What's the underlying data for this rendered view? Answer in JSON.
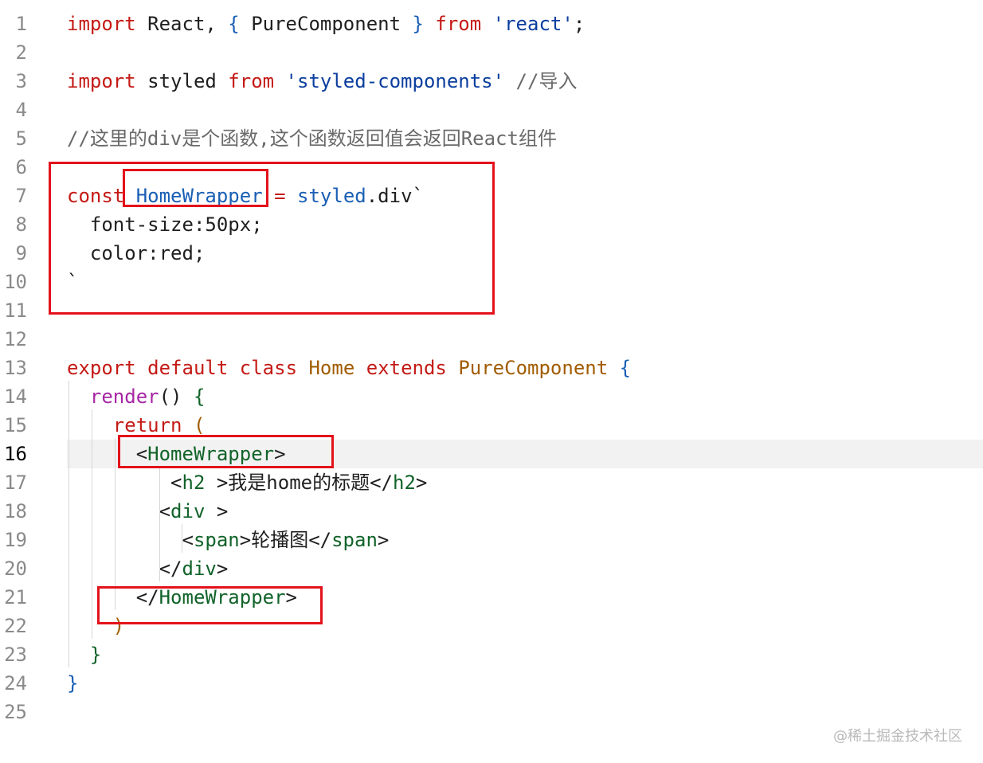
{
  "colors": {
    "keyword": "#c41a16",
    "method": "#a626a4",
    "string": "#0b3e9e",
    "comment": "#6a6a6a",
    "tag": "#116329",
    "class_name": "#a15c00",
    "annotation_box": "#e3121b",
    "current_line_bg": "#f2f2f2"
  },
  "lines": [
    {
      "n": "1",
      "tokens": [
        {
          "c": "kw",
          "t": "import"
        },
        {
          "c": "plain",
          "t": " React, "
        },
        {
          "c": "brace",
          "t": "{"
        },
        {
          "c": "plain",
          "t": " PureComponent "
        },
        {
          "c": "brace",
          "t": "}"
        },
        {
          "c": "plain",
          "t": " "
        },
        {
          "c": "kw",
          "t": "from"
        },
        {
          "c": "plain",
          "t": " "
        },
        {
          "c": "str",
          "t": "'react'"
        },
        {
          "c": "plain",
          "t": ";"
        }
      ]
    },
    {
      "n": "2",
      "tokens": []
    },
    {
      "n": "3",
      "tokens": [
        {
          "c": "kw",
          "t": "import"
        },
        {
          "c": "plain",
          "t": " styled "
        },
        {
          "c": "kw",
          "t": "from"
        },
        {
          "c": "plain",
          "t": " "
        },
        {
          "c": "str",
          "t": "'styled-components'"
        },
        {
          "c": "plain",
          "t": " "
        },
        {
          "c": "cm",
          "t": "//导入"
        }
      ]
    },
    {
      "n": "4",
      "tokens": []
    },
    {
      "n": "5",
      "tokens": [
        {
          "c": "cm",
          "t": "//这里的div是个函数,这个函数返回值会返回React组件"
        }
      ]
    },
    {
      "n": "6",
      "tokens": []
    },
    {
      "n": "7",
      "tokens": [
        {
          "c": "kw",
          "t": "const"
        },
        {
          "c": "plain",
          "t": " "
        },
        {
          "c": "fn",
          "t": "HomeWrapper"
        },
        {
          "c": "plain",
          "t": " "
        },
        {
          "c": "kw",
          "t": "="
        },
        {
          "c": "plain",
          "t": " "
        },
        {
          "c": "fn",
          "t": "styled"
        },
        {
          "c": "plain",
          "t": ".div`"
        }
      ]
    },
    {
      "n": "8",
      "tokens": [
        {
          "c": "plain",
          "t": "  font-size:50px;"
        }
      ]
    },
    {
      "n": "9",
      "tokens": [
        {
          "c": "plain",
          "t": "  color:red;"
        }
      ]
    },
    {
      "n": "10",
      "tokens": [
        {
          "c": "plain",
          "t": "`"
        }
      ]
    },
    {
      "n": "11",
      "tokens": []
    },
    {
      "n": "12",
      "tokens": []
    },
    {
      "n": "13",
      "tokens": [
        {
          "c": "kw",
          "t": "export"
        },
        {
          "c": "plain",
          "t": " "
        },
        {
          "c": "kw",
          "t": "default"
        },
        {
          "c": "plain",
          "t": " "
        },
        {
          "c": "kw",
          "t": "class"
        },
        {
          "c": "plain",
          "t": " "
        },
        {
          "c": "cls",
          "t": "Home"
        },
        {
          "c": "plain",
          "t": " "
        },
        {
          "c": "kw",
          "t": "extends"
        },
        {
          "c": "plain",
          "t": " "
        },
        {
          "c": "cls",
          "t": "PureComponent"
        },
        {
          "c": "plain",
          "t": " "
        },
        {
          "c": "brace",
          "t": "{"
        }
      ]
    },
    {
      "n": "14",
      "tokens": [
        {
          "c": "plain",
          "t": "  "
        },
        {
          "c": "kw2",
          "t": "render"
        },
        {
          "c": "plain",
          "t": "() "
        },
        {
          "c": "tag",
          "t": "{"
        }
      ]
    },
    {
      "n": "15",
      "tokens": [
        {
          "c": "plain",
          "t": "    "
        },
        {
          "c": "kw",
          "t": "return"
        },
        {
          "c": "plain",
          "t": " "
        },
        {
          "c": "cls",
          "t": "("
        }
      ]
    },
    {
      "n": "16",
      "current": true,
      "tokens": [
        {
          "c": "plain",
          "t": "      <"
        },
        {
          "c": "tag",
          "t": "HomeWrapper"
        },
        {
          "c": "plain",
          "t": ">"
        }
      ]
    },
    {
      "n": "17",
      "tokens": [
        {
          "c": "plain",
          "t": "         <"
        },
        {
          "c": "tag",
          "t": "h2"
        },
        {
          "c": "plain",
          "t": " >我是home的标题</"
        },
        {
          "c": "tag",
          "t": "h2"
        },
        {
          "c": "plain",
          "t": ">"
        }
      ]
    },
    {
      "n": "18",
      "tokens": [
        {
          "c": "plain",
          "t": "        <"
        },
        {
          "c": "tag",
          "t": "div"
        },
        {
          "c": "plain",
          "t": " >"
        }
      ]
    },
    {
      "n": "19",
      "tokens": [
        {
          "c": "plain",
          "t": "          <"
        },
        {
          "c": "tag",
          "t": "span"
        },
        {
          "c": "plain",
          "t": ">轮播图</"
        },
        {
          "c": "tag",
          "t": "span"
        },
        {
          "c": "plain",
          "t": ">"
        }
      ]
    },
    {
      "n": "20",
      "tokens": [
        {
          "c": "plain",
          "t": "        </"
        },
        {
          "c": "tag",
          "t": "div"
        },
        {
          "c": "plain",
          "t": ">"
        }
      ]
    },
    {
      "n": "21",
      "tokens": [
        {
          "c": "plain",
          "t": "      </"
        },
        {
          "c": "tag",
          "t": "HomeWrapper"
        },
        {
          "c": "plain",
          "t": ">"
        }
      ]
    },
    {
      "n": "22",
      "tokens": [
        {
          "c": "plain",
          "t": "    "
        },
        {
          "c": "cls",
          "t": ")"
        }
      ]
    },
    {
      "n": "23",
      "tokens": [
        {
          "c": "plain",
          "t": "  "
        },
        {
          "c": "tag",
          "t": "}"
        }
      ]
    },
    {
      "n": "24",
      "tokens": [
        {
          "c": "brace",
          "t": "}"
        }
      ]
    },
    {
      "n": "25",
      "tokens": []
    }
  ],
  "watermark": "@稀土掘金技术社区"
}
